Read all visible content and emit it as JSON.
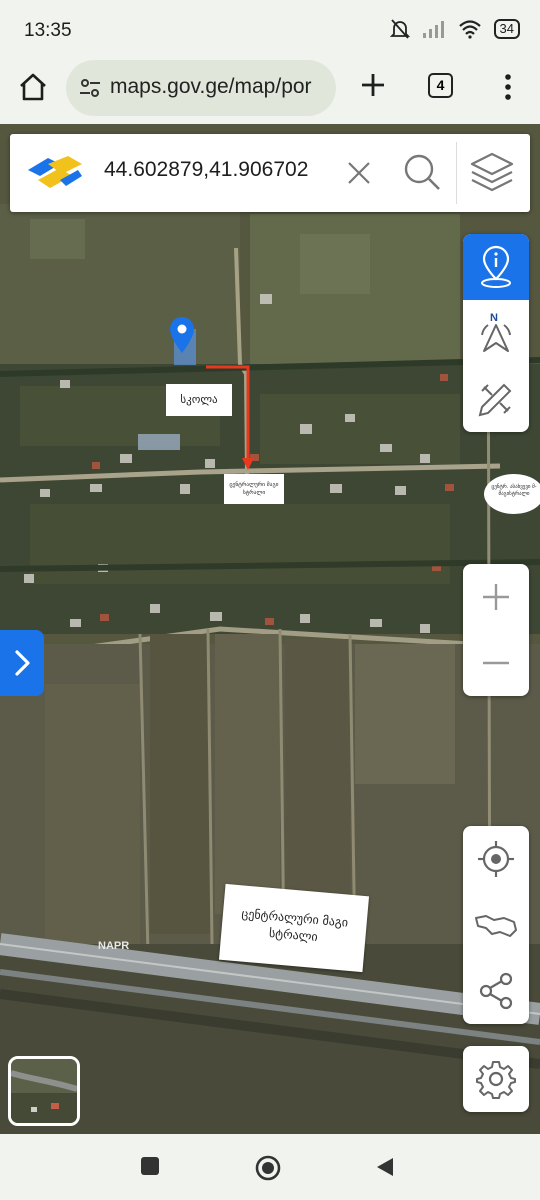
{
  "status_bar": {
    "time": "13:35",
    "battery": "34",
    "icons": [
      "mute-bell-icon",
      "signal-icon",
      "wifi-icon",
      "battery-icon"
    ]
  },
  "browser": {
    "url": "maps.gov.ge/map/por",
    "tab_count": "4",
    "icons": [
      "home-icon",
      "site-info-icon",
      "plus-icon",
      "menu-dots-icon"
    ]
  },
  "search": {
    "value": "44.602879,41.906702",
    "icons": [
      "logo",
      "close-icon",
      "search-icon",
      "layers-icon"
    ]
  },
  "map": {
    "watermark": "NAPR",
    "pin_color": "#1a73e8",
    "arrow_color": "#e8381e"
  },
  "callouts": {
    "school": "სკოლა",
    "center_road_small": "ცენტრალური მაგი სტრალი",
    "right_label": "ცენტრ. ასახვევი მ-მაგისტრალი",
    "highway": "ცენტრალური მაგი სტრალი"
  },
  "toolbar": {
    "top_tools": [
      "info-pin-icon",
      "compass-north-icon",
      "measure-tools-icon"
    ],
    "compass_letter": "N",
    "zoom": [
      "zoom-in-icon",
      "zoom-out-icon"
    ],
    "bottom_tools": [
      "locate-icon",
      "georgia-map-icon",
      "share-icon"
    ],
    "settings": "gear-icon"
  },
  "nav_bar": [
    "recent-apps-icon",
    "home-circle-icon",
    "back-icon"
  ],
  "colors": {
    "accent": "#1a73e8",
    "bar_bg": "#f1f4ee"
  }
}
